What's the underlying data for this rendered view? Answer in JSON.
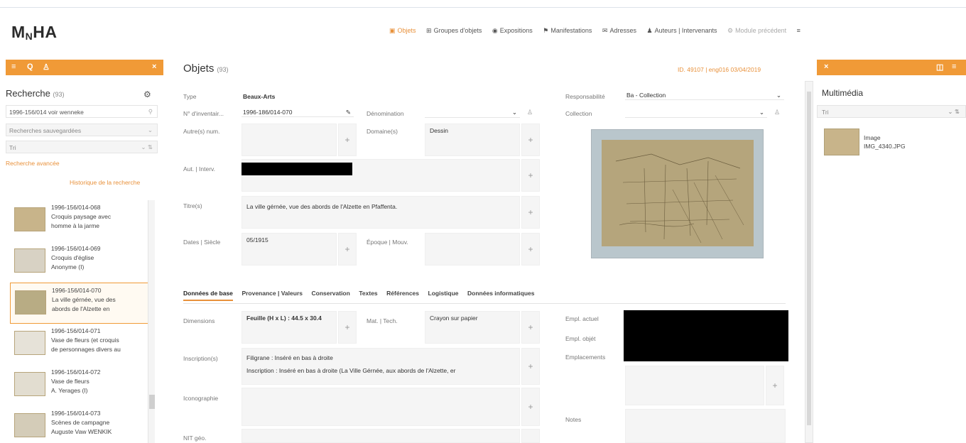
{
  "header": {
    "logo": {
      "pre": "M",
      "sub": "N",
      "post": "HA"
    },
    "nav": [
      {
        "icon": "▣",
        "label": "Objets",
        "active": true
      },
      {
        "icon": "⊞",
        "label": "Groupes d'objets"
      },
      {
        "icon": "◉",
        "label": "Expositions"
      },
      {
        "icon": "⚑",
        "label": "Manifestations"
      },
      {
        "icon": "✉",
        "label": "Adresses"
      },
      {
        "icon": "♟",
        "label": "Auteurs | Intervenants"
      },
      {
        "icon": "⚙",
        "label": "Module précédent",
        "faded": true
      },
      {
        "icon": "≡",
        "label": ""
      }
    ]
  },
  "left": {
    "icons": {
      "menu": "≡",
      "search": "Q",
      "tree": "♙",
      "close": "×"
    },
    "title": "Recherche",
    "count": "(93)",
    "query": "1996-156/014 voir wenneke",
    "saved_searches": "Recherches sauvegardées",
    "tri": "Tri",
    "exact": "Recherche avancée",
    "history": "Historique de la recherche",
    "results": [
      {
        "id": "1996-156/014-068",
        "l1": "Croquis paysage avec",
        "l2": "homme à la jarme"
      },
      {
        "id": "1996-156/014-069",
        "l1": "Croquis d'église",
        "l2": "Anonyme (I)"
      },
      {
        "id": "1996-156/014-070",
        "l1": "La ville gérnée, vue des",
        "l2": "abords de l'Alzette en",
        "selected": true
      },
      {
        "id": "1996-156/014-071",
        "l1": "Vase de fleurs (et croquis",
        "l2": "de personnages divers au"
      },
      {
        "id": "1996-156/014-072",
        "l1": "Vase de fleurs",
        "l2": "A. Yerages (I)"
      },
      {
        "id": "1996-156/014-073",
        "l1": "Scènes de campagne",
        "l2": "Auguste Vaw WENKIK"
      }
    ]
  },
  "main": {
    "title": "Objets",
    "count": "(93)",
    "id_line": "ID. 49107 | eng016 03/04/2019",
    "labels": {
      "type": "Type",
      "inventaire": "N° d'inventair...",
      "autres_num": "Autre(s) num.",
      "aut_interv": "Aut. | Interv.",
      "titre": "Titre(s)",
      "dates": "Dates | Siècle",
      "denomination": "Dénomination",
      "domaine": "Domaine(s)",
      "epoque": "Époque | Mouv.",
      "responsabilite": "Responsabilité",
      "collection": "Collection"
    },
    "values": {
      "type": "Beaux-Arts",
      "inventaire": "1996-186/014-070",
      "domaine": "Dessin",
      "titre": "La ville gérnée, vue des abords de l'Alzette en Pfaffenta.",
      "dates": "05/1915",
      "responsabilite": "Ba - Collection"
    },
    "tabs": [
      "Données de base",
      "Provenance | Valeurs",
      "Conservation",
      "Textes",
      "Références",
      "Logistique",
      "Données informatiques"
    ],
    "base": {
      "dimensions_label": "Dimensions",
      "dimensions_value": "Feuille (H x L) : 44.5 x 30.4",
      "mat_tech_label": "Mat. | Tech.",
      "mat_tech_value": "Crayon sur papier",
      "inscription_label": "Inscription(s)",
      "inscription_1": "Filigrane : Inséré en bas à droite",
      "inscription_2": "Inscription : Inséré en bas à droite (La Ville Gérnée, aux abords de l'Alzette, er",
      "iconographie_label": "Iconographie",
      "nat_geo_label": "NIT géo.",
      "empl_actuel": "Empl. actuel",
      "empl_objet": "Empl. objét",
      "emplacements": "Emplacements",
      "notes": "Notes"
    }
  },
  "right": {
    "title": "Multimédia",
    "tri": "Tri",
    "media_type": "Image",
    "media_file": "IMG_4340.JPG"
  }
}
